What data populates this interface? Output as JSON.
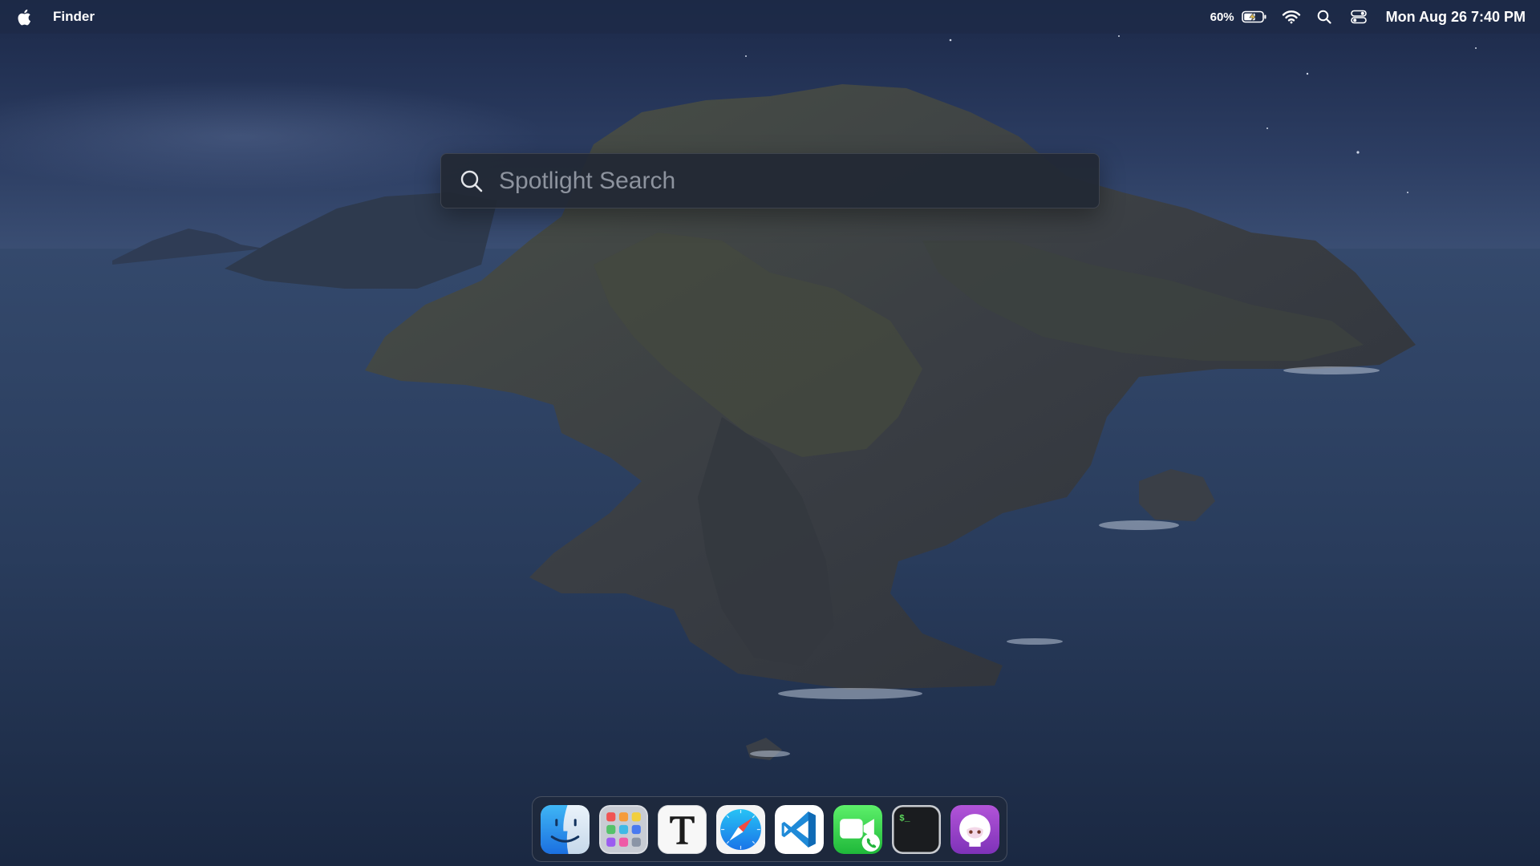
{
  "menubar": {
    "apple_icon": "apple-logo-icon",
    "app_name": "Finder",
    "battery_percent": "60%",
    "battery_icon": "battery-charging-icon",
    "wifi_icon": "wifi-icon",
    "search_icon": "search-icon",
    "control_center_icon": "control-center-icon",
    "clock": "Mon Aug 26 7:40 PM"
  },
  "spotlight": {
    "icon": "search-icon",
    "placeholder": "Spotlight Search",
    "value": ""
  },
  "dock": {
    "items": [
      {
        "app": "Finder",
        "icon": "finder-icon"
      },
      {
        "app": "Launchpad",
        "icon": "launchpad-icon"
      },
      {
        "app": "Typora",
        "icon": "typora-icon"
      },
      {
        "app": "Safari",
        "icon": "safari-icon"
      },
      {
        "app": "Visual Studio Code",
        "icon": "vscode-icon"
      },
      {
        "app": "FaceTime",
        "icon": "facetime-icon"
      },
      {
        "app": "Terminal",
        "icon": "terminal-icon"
      },
      {
        "app": "GitHub Desktop",
        "icon": "github-icon"
      }
    ]
  },
  "colors": {
    "sky_top": "#1c2a4a",
    "sea": "#2a3e5e",
    "island": "#3b4048",
    "spotlight_bg": "#222834",
    "dock_bg": "#1e283a"
  }
}
